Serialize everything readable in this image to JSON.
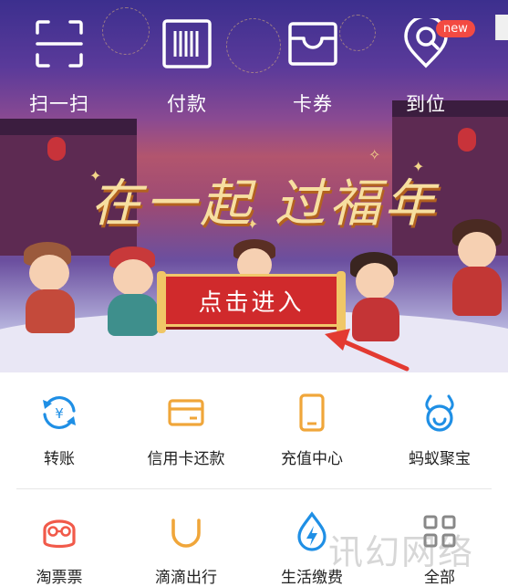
{
  "quick_actions": [
    {
      "label": "扫一扫",
      "icon": "scan-icon"
    },
    {
      "label": "付款",
      "icon": "barcode-icon"
    },
    {
      "label": "卡券",
      "icon": "card-voucher-icon"
    },
    {
      "label": "到位",
      "icon": "location-pin-icon",
      "badge": "new"
    }
  ],
  "banner": {
    "headline": "在一起 过福年",
    "enter_button": "点击进入",
    "accent_color": "#d02a2c"
  },
  "services_row1": [
    {
      "label": "转账",
      "icon": "transfer-icon",
      "color": "#1f8fe5"
    },
    {
      "label": "信用卡还款",
      "icon": "credit-card-icon",
      "color": "#f0a63a"
    },
    {
      "label": "充值中心",
      "icon": "phone-recharge-icon",
      "color": "#f0a63a"
    },
    {
      "label": "蚂蚁聚宝",
      "icon": "ant-fortune-icon",
      "color": "#1f8fe5"
    }
  ],
  "services_row2": [
    {
      "label": "淘票票",
      "icon": "taopiaopiao-icon",
      "color": "#f15a4a"
    },
    {
      "label": "滴滴出行",
      "icon": "didi-icon",
      "color": "#f0a63a"
    },
    {
      "label": "生活缴费",
      "icon": "utility-bill-icon",
      "color": "#1f8fe5"
    },
    {
      "label": "全部",
      "icon": "all-grid-icon",
      "color": "#888888"
    }
  ],
  "watermark": "讯幻网络"
}
